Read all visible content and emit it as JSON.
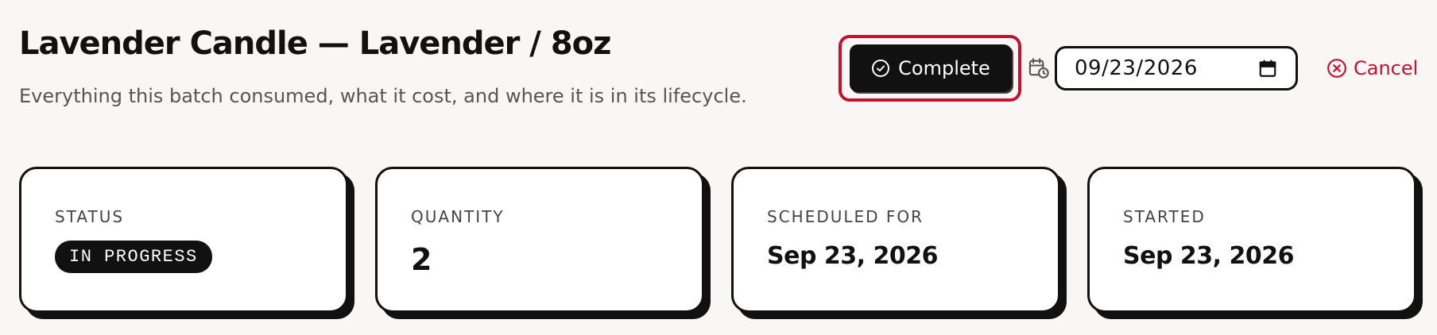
{
  "header": {
    "title": "Lavender Candle — Lavender / 8oz",
    "subtitle": "Everything this batch consumed, what it cost, and where it is in its lifecycle."
  },
  "actions": {
    "complete_label": "Complete",
    "complete_icon": "check-circle-icon",
    "schedule_icon": "calendar-clock-icon",
    "date_value": "09/23/2026",
    "date_picker_icon": "calendar-icon",
    "cancel_label": "Cancel",
    "cancel_icon": "x-circle-icon"
  },
  "cards": [
    {
      "label": "STATUS",
      "badge": "IN PROGRESS"
    },
    {
      "label": "QUANTITY",
      "value": "2"
    },
    {
      "label": "SCHEDULED FOR",
      "value": "Sep 23, 2026"
    },
    {
      "label": "STARTED",
      "value": "Sep 23, 2026"
    }
  ],
  "colors": {
    "background": "#f8f7f5",
    "primary": "#111111",
    "danger": "#c8102e",
    "focus_ring": "#c8102e"
  }
}
